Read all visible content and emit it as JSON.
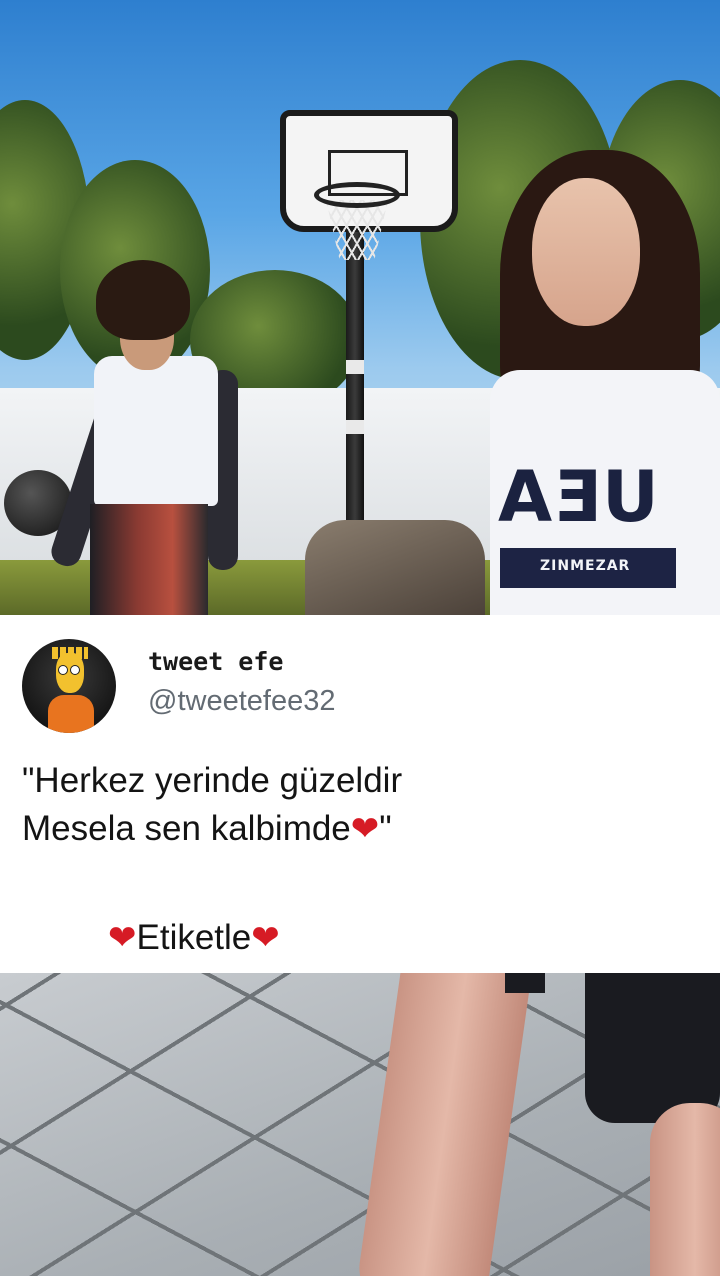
{
  "tweet": {
    "display_name": "tweet efe",
    "handle": "@tweetefee32",
    "text_line1": "\"Herkez yerinde güzeldir",
    "text_line2_prefix": "Mesela sen kalbimde",
    "text_line2_suffix": "\"",
    "tag_label": "Etiketle",
    "heart": "❤"
  },
  "photo_top": {
    "jersey_logo": "AƎU",
    "jersey_band": "ZINMEZAR"
  },
  "colors": {
    "heart": "#d61b25",
    "handle": "#636b73",
    "text": "#141414"
  }
}
